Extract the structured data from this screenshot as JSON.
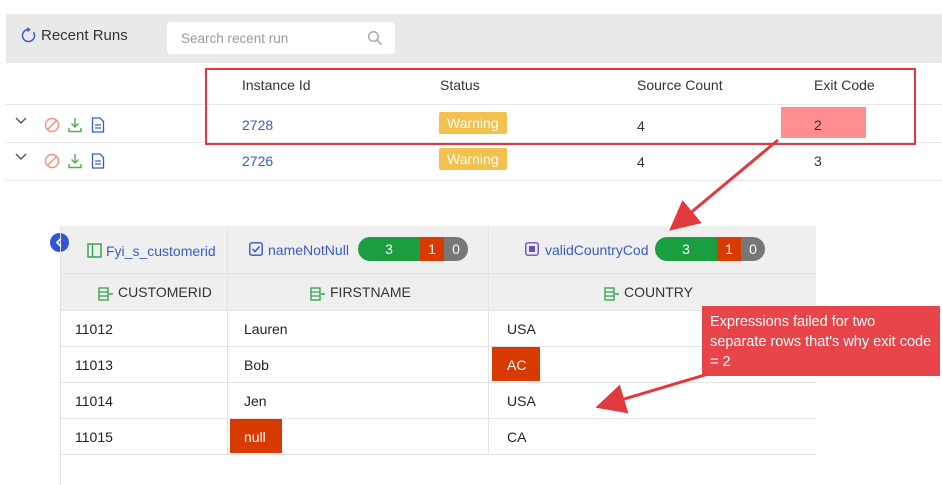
{
  "header": {
    "title": "Recent Runs",
    "search_placeholder": "Search recent run"
  },
  "runs_table": {
    "columns": [
      "Instance Id",
      "Status",
      "Source Count",
      "Exit Code"
    ],
    "rows": [
      {
        "instance_id": "2728",
        "status": "Warning",
        "source_count": "4",
        "exit_code": "2"
      },
      {
        "instance_id": "2726",
        "status": "Warning",
        "source_count": "4",
        "exit_code": "3"
      }
    ]
  },
  "detail_panel": {
    "file_column": "Fyi_s_customerid",
    "rules": [
      {
        "name": "nameNotNull",
        "pass": "3",
        "fail": "1",
        "other": "0"
      },
      {
        "name": "validCountryCod",
        "pass": "3",
        "fail": "1",
        "other": "0"
      }
    ],
    "columns": [
      "CUSTOMERID",
      "FIRSTNAME",
      "COUNTRY"
    ],
    "rows": [
      [
        "11012",
        "Lauren",
        "USA"
      ],
      [
        "11013",
        "Bob",
        "AC"
      ],
      [
        "11014",
        "Jen",
        "USA"
      ],
      [
        "11015",
        "null",
        "CA"
      ]
    ]
  },
  "annotation": {
    "callout_text": "Expressions failed for two separate rows that's why exit code = 2"
  },
  "colors": {
    "warning": "#f2c14e",
    "exit_highlight": "#ff8d91",
    "error_cell": "#d83b01",
    "pass": "#1a9e3f",
    "annotation": "#e1393d",
    "link": "#3a5cc7"
  }
}
